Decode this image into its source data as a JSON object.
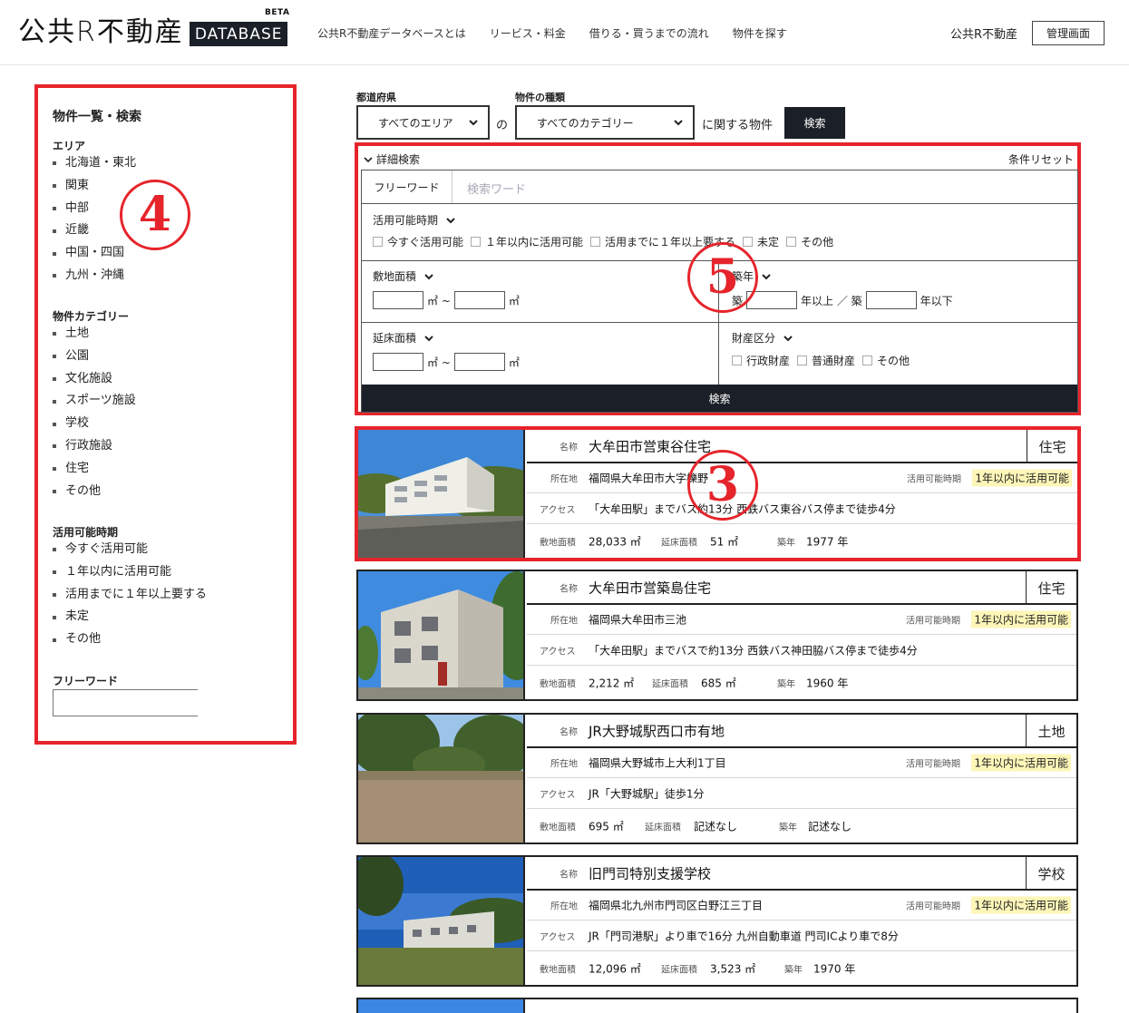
{
  "header": {
    "logo_text": "公共R不動産",
    "logo_badge": "DATABASE",
    "beta": "BETA",
    "nav": [
      "公共R不動産データベースとは",
      "リービス・料金",
      "借りる・買うまでの流れ",
      "物件を探す"
    ],
    "org_name": "公共R不動産",
    "admin_label": "管理画面"
  },
  "sidebar": {
    "title": "物件一覧・検索",
    "area_heading": "エリア",
    "areas": [
      "北海道・東北",
      "関東",
      "中部",
      "近畿",
      "中国・四国",
      "九州・沖縄"
    ],
    "category_heading": "物件カテゴリー",
    "categories": [
      "土地",
      "公園",
      "文化施設",
      "スポーツ施設",
      "学校",
      "行政施設",
      "住宅",
      "その他"
    ],
    "period_heading": "活用可能時期",
    "periods": [
      "今すぐ活用可能",
      "１年以内に活用可能",
      "活用までに１年以上要する",
      "未定",
      "その他"
    ],
    "freeword_heading": "フリーワード"
  },
  "annotations": {
    "four": "4",
    "five": "5",
    "three": "3"
  },
  "search": {
    "pref_label": "都道府県",
    "pref_value": "すべてのエリア",
    "of_text": "の",
    "kind_label": "物件の種類",
    "kind_value": "すべてのカテゴリー",
    "suffix": "に関する物件",
    "button": "検索"
  },
  "detail": {
    "toggle": "詳細検索",
    "reset": "条件リセット",
    "freeword_label": "フリーワード",
    "freeword_placeholder": "検索ワード",
    "period_label": "活用可能時期",
    "period_options": [
      "今すぐ活用可能",
      "１年以内に活用可能",
      "活用までに１年以上要する",
      "未定",
      "その他"
    ],
    "site_area_label": "敷地面積",
    "built_label": "築年",
    "built_prefix": "築",
    "built_mid": "年以上 ／ 築",
    "built_suffix": "年以下",
    "floor_area_label": "延床面積",
    "property_class_label": "財産区分",
    "property_class_options": [
      "行政財産",
      "普通財産",
      "その他"
    ],
    "unit": "㎡",
    "unit_tilde": "㎡ ~",
    "submit": "検索"
  },
  "labels": {
    "name": "名称",
    "location": "所在地",
    "available": "活用可能時期",
    "access": "アクセス",
    "site_area": "敷地面積",
    "floor_area": "延床面積",
    "built": "築年"
  },
  "properties": [
    {
      "name": "大牟田市営東谷住宅",
      "category": "住宅",
      "location": "福岡県大牟田市大字櫟野",
      "available": "1年以内に活用可能",
      "access": "「大牟田駅」までバス約13分 西鉄バス東谷バス停まで徒歩4分",
      "site_area": "28,033 ㎡",
      "floor_area": "51 ㎡",
      "built": "1977 年"
    },
    {
      "name": "大牟田市営築島住宅",
      "category": "住宅",
      "location": "福岡県大牟田市三池",
      "available": "1年以内に活用可能",
      "access": "「大牟田駅」までバスで約13分 西鉄バス神田脇バス停まで徒歩4分",
      "site_area": "2,212 ㎡",
      "floor_area": "685 ㎡",
      "built": "1960 年"
    },
    {
      "name": "JR大野城駅西口市有地",
      "category": "土地",
      "location": "福岡県大野城市上大利1丁目",
      "available": "1年以内に活用可能",
      "access": "JR「大野城駅」徒歩1分",
      "site_area": "695 ㎡",
      "floor_area": "記述なし",
      "built": "記述なし"
    },
    {
      "name": "旧門司特別支援学校",
      "category": "学校",
      "location": "福岡県北九州市門司区白野江三丁目",
      "available": "1年以内に活用可能",
      "access": "JR「門司港駅」より車で16分 九州自動車道 門司ICより車で8分",
      "site_area": "12,096 ㎡",
      "floor_area": "3,523 ㎡",
      "built": "1970 年"
    }
  ]
}
